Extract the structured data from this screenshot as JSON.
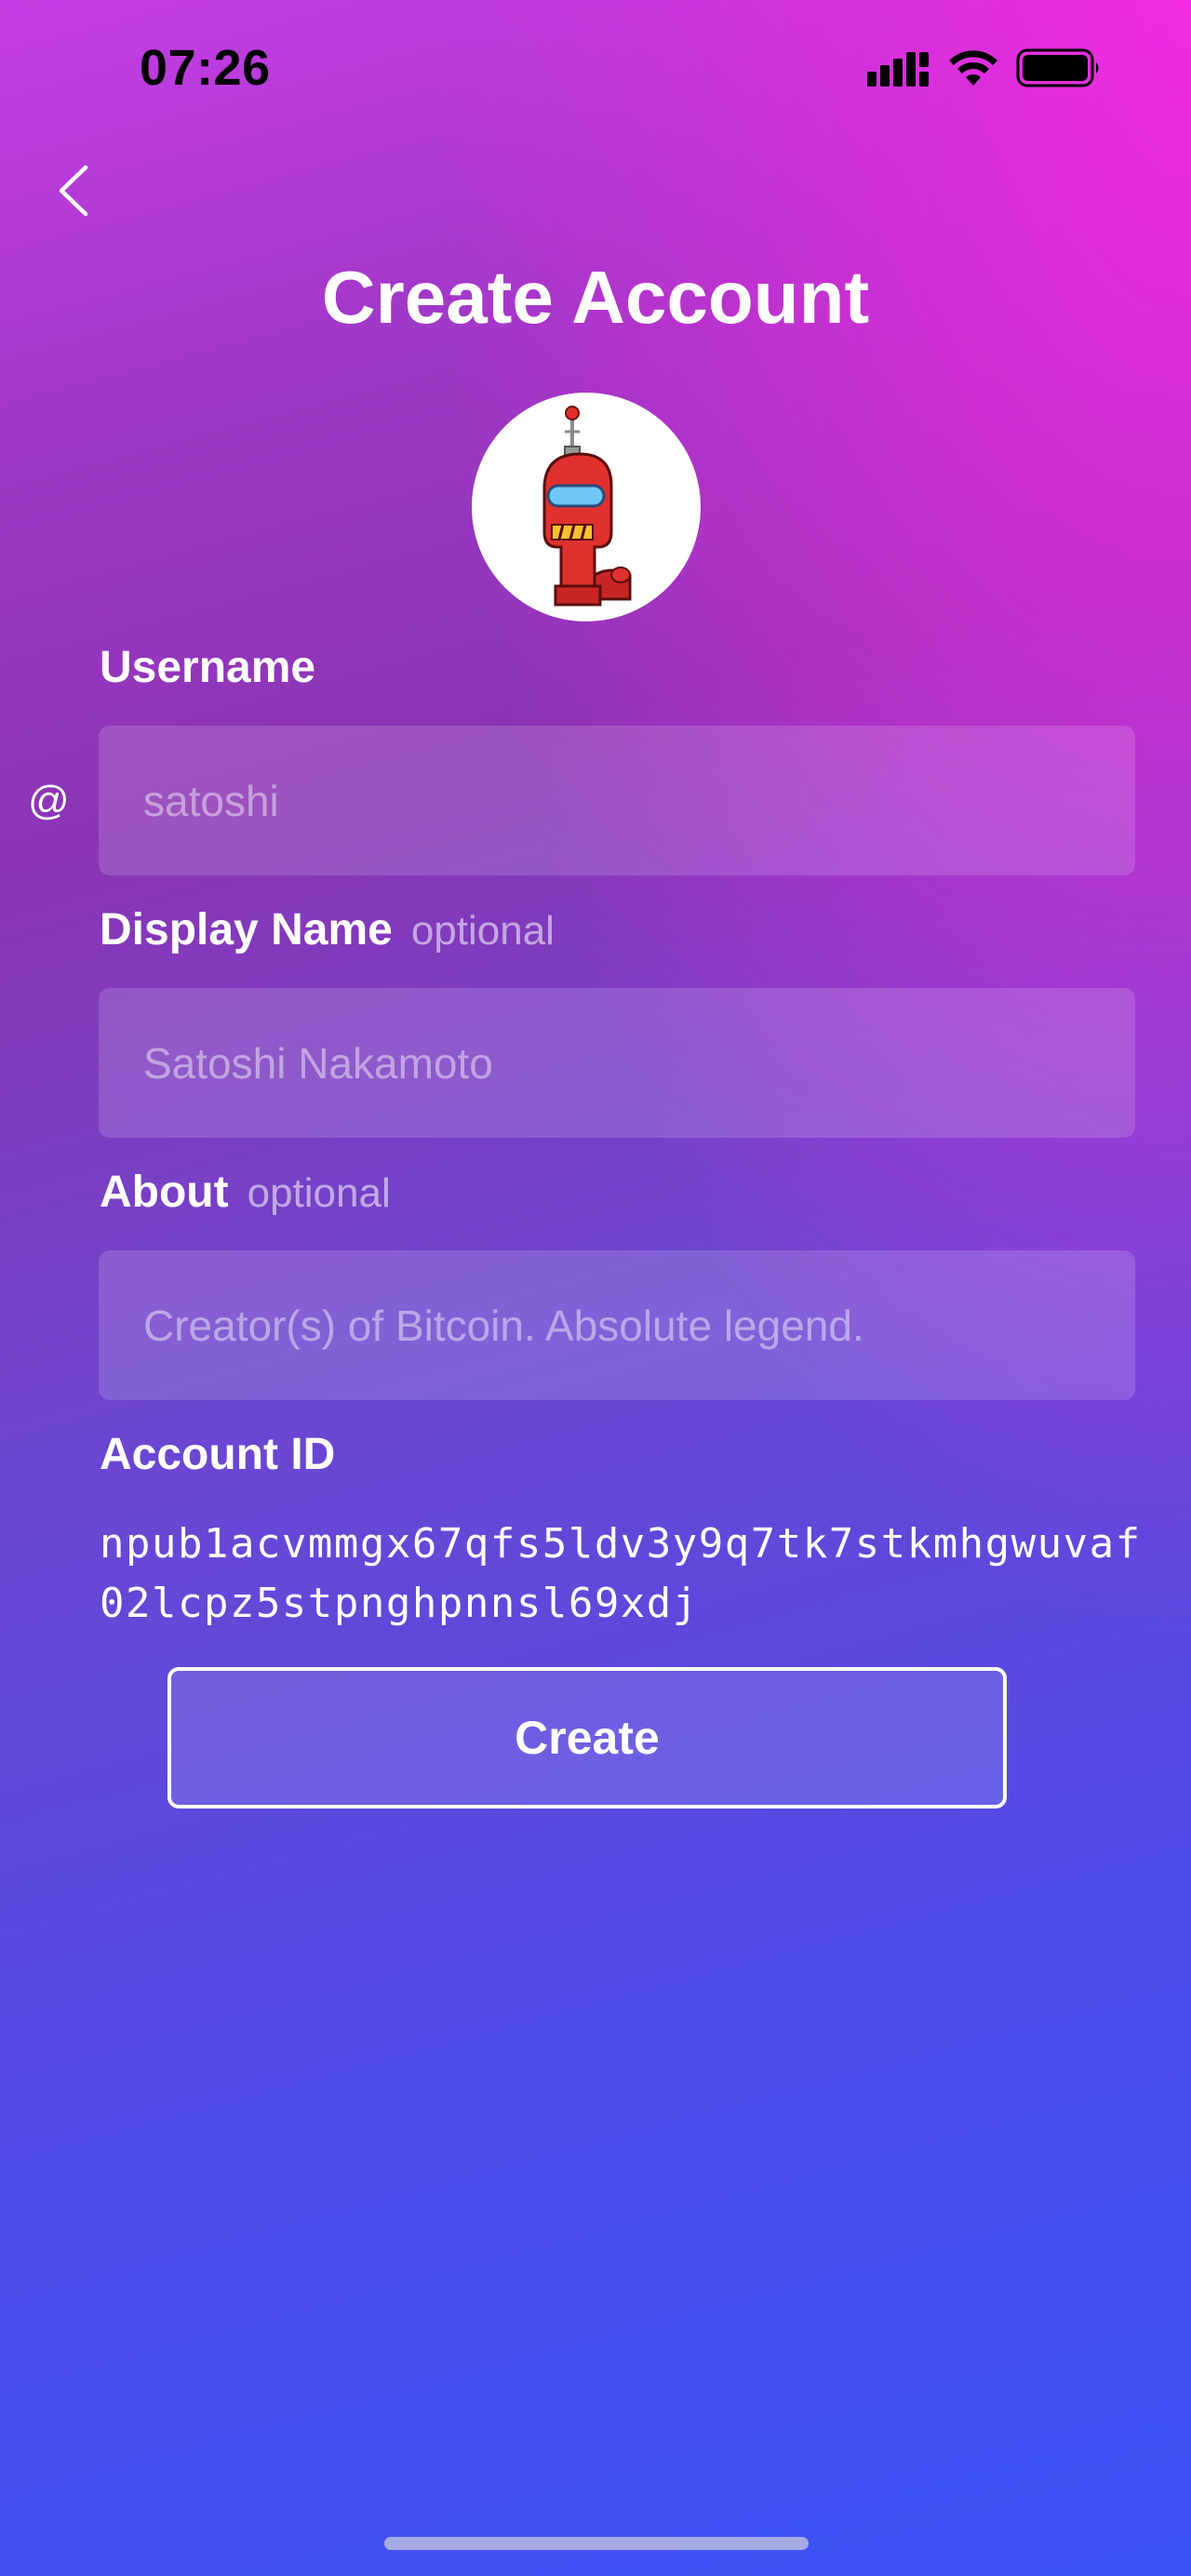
{
  "status_bar": {
    "time": "07:26",
    "icons": [
      "cellular-signal-icon",
      "wifi-icon",
      "battery-icon"
    ]
  },
  "nav": {
    "back_icon": "chevron-left-icon"
  },
  "page": {
    "title": "Create Account"
  },
  "avatar": {
    "icon": "robot-avatar-icon"
  },
  "form": {
    "username": {
      "label": "Username",
      "prefix": "@",
      "placeholder": "satoshi",
      "value": ""
    },
    "display_name": {
      "label": "Display Name",
      "optional_hint": "optional",
      "placeholder": "Satoshi Nakamoto",
      "value": ""
    },
    "about": {
      "label": "About",
      "optional_hint": "optional",
      "placeholder": "Creator(s) of Bitcoin. Absolute legend.",
      "value": ""
    },
    "account_id": {
      "label": "Account ID",
      "value": "npub1acvmmgx67qfs5ldv3y9q7tk7stkmhgwuvaf02lcpz5stpnghpnnsl69xdj"
    }
  },
  "actions": {
    "create_label": "Create"
  },
  "colors": {
    "gradient_top_right": "#ff2ee6",
    "gradient_mid": "#8a35b4",
    "gradient_bottom": "#3a53f7",
    "text": "#ffffff"
  }
}
